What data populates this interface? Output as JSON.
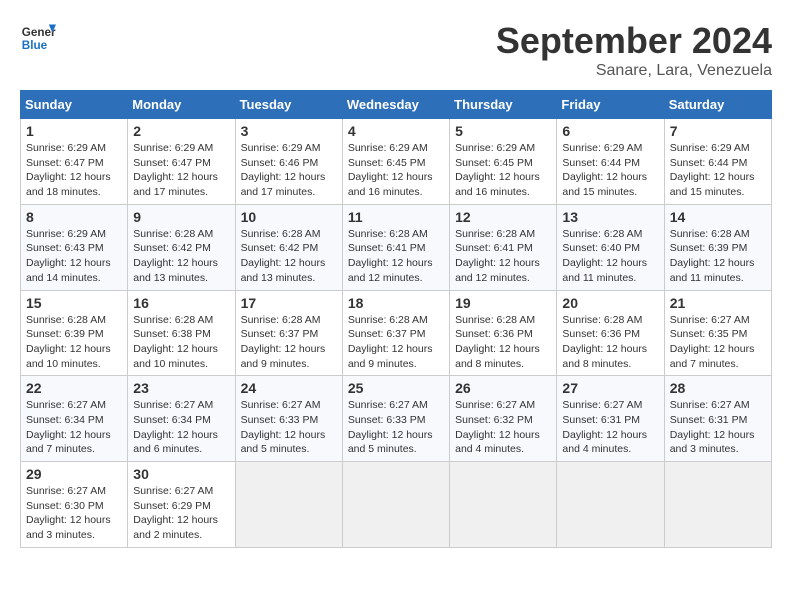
{
  "header": {
    "logo_general": "General",
    "logo_blue": "Blue",
    "month_title": "September 2024",
    "subtitle": "Sanare, Lara, Venezuela"
  },
  "calendar": {
    "days_of_week": [
      "Sunday",
      "Monday",
      "Tuesday",
      "Wednesday",
      "Thursday",
      "Friday",
      "Saturday"
    ],
    "weeks": [
      [
        {
          "day": "1",
          "sunrise": "6:29 AM",
          "sunset": "6:47 PM",
          "daylight": "12 hours and 18 minutes."
        },
        {
          "day": "2",
          "sunrise": "6:29 AM",
          "sunset": "6:47 PM",
          "daylight": "12 hours and 17 minutes."
        },
        {
          "day": "3",
          "sunrise": "6:29 AM",
          "sunset": "6:46 PM",
          "daylight": "12 hours and 17 minutes."
        },
        {
          "day": "4",
          "sunrise": "6:29 AM",
          "sunset": "6:45 PM",
          "daylight": "12 hours and 16 minutes."
        },
        {
          "day": "5",
          "sunrise": "6:29 AM",
          "sunset": "6:45 PM",
          "daylight": "12 hours and 16 minutes."
        },
        {
          "day": "6",
          "sunrise": "6:29 AM",
          "sunset": "6:44 PM",
          "daylight": "12 hours and 15 minutes."
        },
        {
          "day": "7",
          "sunrise": "6:29 AM",
          "sunset": "6:44 PM",
          "daylight": "12 hours and 15 minutes."
        }
      ],
      [
        {
          "day": "8",
          "sunrise": "6:29 AM",
          "sunset": "6:43 PM",
          "daylight": "12 hours and 14 minutes."
        },
        {
          "day": "9",
          "sunrise": "6:28 AM",
          "sunset": "6:42 PM",
          "daylight": "12 hours and 13 minutes."
        },
        {
          "day": "10",
          "sunrise": "6:28 AM",
          "sunset": "6:42 PM",
          "daylight": "12 hours and 13 minutes."
        },
        {
          "day": "11",
          "sunrise": "6:28 AM",
          "sunset": "6:41 PM",
          "daylight": "12 hours and 12 minutes."
        },
        {
          "day": "12",
          "sunrise": "6:28 AM",
          "sunset": "6:41 PM",
          "daylight": "12 hours and 12 minutes."
        },
        {
          "day": "13",
          "sunrise": "6:28 AM",
          "sunset": "6:40 PM",
          "daylight": "12 hours and 11 minutes."
        },
        {
          "day": "14",
          "sunrise": "6:28 AM",
          "sunset": "6:39 PM",
          "daylight": "12 hours and 11 minutes."
        }
      ],
      [
        {
          "day": "15",
          "sunrise": "6:28 AM",
          "sunset": "6:39 PM",
          "daylight": "12 hours and 10 minutes."
        },
        {
          "day": "16",
          "sunrise": "6:28 AM",
          "sunset": "6:38 PM",
          "daylight": "12 hours and 10 minutes."
        },
        {
          "day": "17",
          "sunrise": "6:28 AM",
          "sunset": "6:37 PM",
          "daylight": "12 hours and 9 minutes."
        },
        {
          "day": "18",
          "sunrise": "6:28 AM",
          "sunset": "6:37 PM",
          "daylight": "12 hours and 9 minutes."
        },
        {
          "day": "19",
          "sunrise": "6:28 AM",
          "sunset": "6:36 PM",
          "daylight": "12 hours and 8 minutes."
        },
        {
          "day": "20",
          "sunrise": "6:28 AM",
          "sunset": "6:36 PM",
          "daylight": "12 hours and 8 minutes."
        },
        {
          "day": "21",
          "sunrise": "6:27 AM",
          "sunset": "6:35 PM",
          "daylight": "12 hours and 7 minutes."
        }
      ],
      [
        {
          "day": "22",
          "sunrise": "6:27 AM",
          "sunset": "6:34 PM",
          "daylight": "12 hours and 7 minutes."
        },
        {
          "day": "23",
          "sunrise": "6:27 AM",
          "sunset": "6:34 PM",
          "daylight": "12 hours and 6 minutes."
        },
        {
          "day": "24",
          "sunrise": "6:27 AM",
          "sunset": "6:33 PM",
          "daylight": "12 hours and 5 minutes."
        },
        {
          "day": "25",
          "sunrise": "6:27 AM",
          "sunset": "6:33 PM",
          "daylight": "12 hours and 5 minutes."
        },
        {
          "day": "26",
          "sunrise": "6:27 AM",
          "sunset": "6:32 PM",
          "daylight": "12 hours and 4 minutes."
        },
        {
          "day": "27",
          "sunrise": "6:27 AM",
          "sunset": "6:31 PM",
          "daylight": "12 hours and 4 minutes."
        },
        {
          "day": "28",
          "sunrise": "6:27 AM",
          "sunset": "6:31 PM",
          "daylight": "12 hours and 3 minutes."
        }
      ],
      [
        {
          "day": "29",
          "sunrise": "6:27 AM",
          "sunset": "6:30 PM",
          "daylight": "12 hours and 3 minutes."
        },
        {
          "day": "30",
          "sunrise": "6:27 AM",
          "sunset": "6:29 PM",
          "daylight": "12 hours and 2 minutes."
        },
        {
          "day": "",
          "sunrise": "",
          "sunset": "",
          "daylight": ""
        },
        {
          "day": "",
          "sunrise": "",
          "sunset": "",
          "daylight": ""
        },
        {
          "day": "",
          "sunrise": "",
          "sunset": "",
          "daylight": ""
        },
        {
          "day": "",
          "sunrise": "",
          "sunset": "",
          "daylight": ""
        },
        {
          "day": "",
          "sunrise": "",
          "sunset": "",
          "daylight": ""
        }
      ]
    ]
  }
}
